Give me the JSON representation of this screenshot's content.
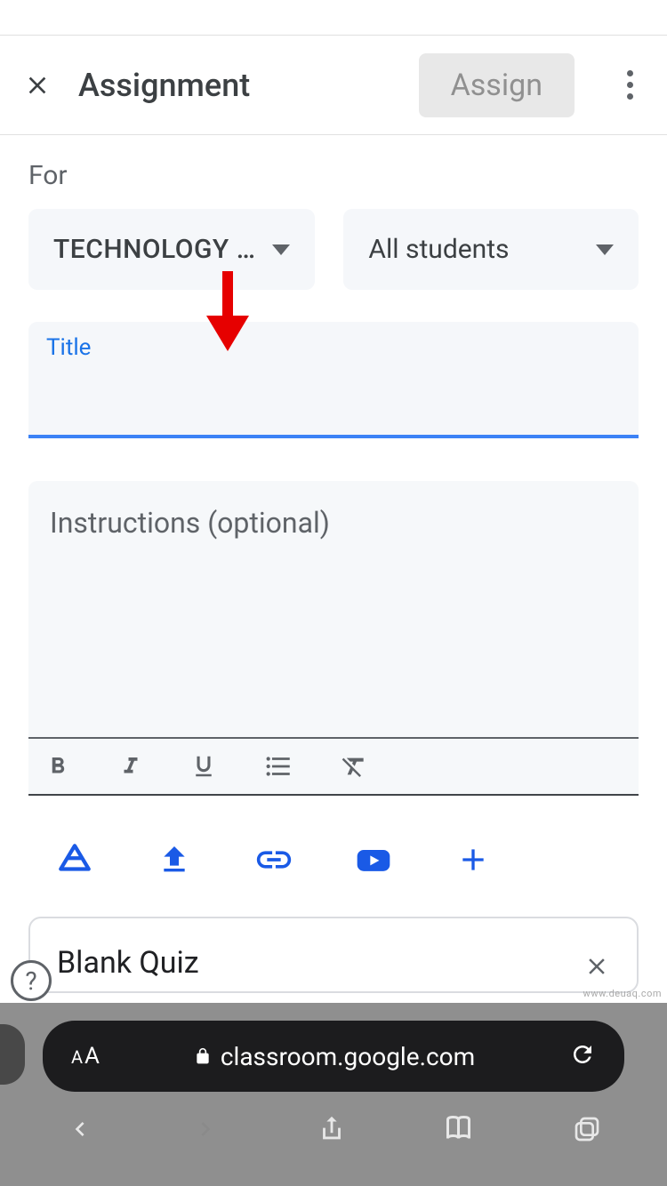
{
  "header": {
    "title": "Assignment",
    "assign_label": "Assign"
  },
  "for": {
    "label": "For",
    "class_name": "TECHNOLOGY …",
    "students": "All students"
  },
  "title_field": {
    "label": "Title",
    "value": ""
  },
  "instructions": {
    "placeholder": "Instructions (optional)"
  },
  "attachments": {
    "quiz_title": "Blank Quiz"
  },
  "browser": {
    "url": "classroom.google.com"
  },
  "colors": {
    "accent_blue": "#1a73e8",
    "arrow_red": "#e60000"
  },
  "icons": {
    "close": "close-icon",
    "more": "more-vert-icon",
    "bold": "bold-icon",
    "italic": "italic-icon",
    "underline": "underline-icon",
    "list": "bulleted-list-icon",
    "clear": "clear-formatting-icon",
    "drive": "drive-icon",
    "upload": "upload-icon",
    "link": "link-icon",
    "youtube": "youtube-icon",
    "add": "add-icon",
    "help": "help-icon",
    "lock": "lock-icon",
    "reload": "reload-icon",
    "back": "back-icon",
    "forward": "forward-icon",
    "share": "share-icon",
    "bookmarks": "bookmarks-icon",
    "tabs": "tabs-icon",
    "text_size": "text-size-icon"
  }
}
